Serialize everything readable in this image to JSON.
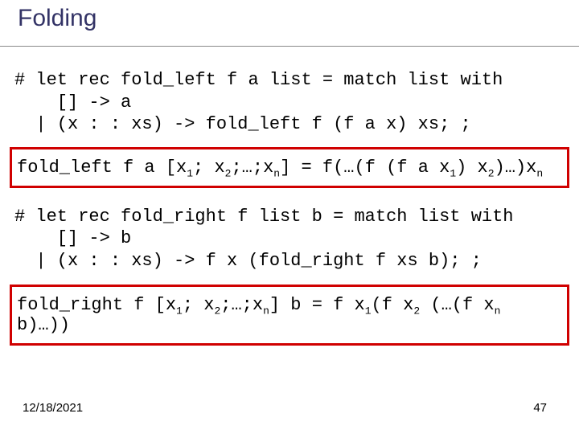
{
  "title": "Folding",
  "code1_l1": "# let rec fold_left f a list = match list with",
  "code1_l2": "    [] -> a",
  "code1_l3": "  | (x : : xs) -> fold_left f (f a x) xs; ;",
  "eq1": {
    "pre": "fold_left f a [x",
    "s1": "1",
    "mid1": "; x",
    "s2": "2",
    "mid2": ";…;x",
    "sn": "n",
    "mid3": "] = f(…(f (f a x",
    "s1b": "1",
    "mid4": ") x",
    "s2b": "2",
    "mid5": ")…)x",
    "snb": "n"
  },
  "code2_l1": "# let rec fold_right f list b = match list with",
  "code2_l2": "    [] -> b",
  "code2_l3": "  | (x : : xs) -> f x (fold_right f xs b); ;",
  "eq2": {
    "pre": "fold_right f [x",
    "s1": "1",
    "mid1": "; x",
    "s2": "2",
    "mid2": ";…;x",
    "sn": "n",
    "mid3": "] b = f x",
    "s1b": "1",
    "mid4": "(f x",
    "s2b": "2",
    "mid5": " (…(f x",
    "snb": "n",
    "tail": " b)…))"
  },
  "footer": {
    "date": "12/18/2021",
    "page": "47"
  }
}
